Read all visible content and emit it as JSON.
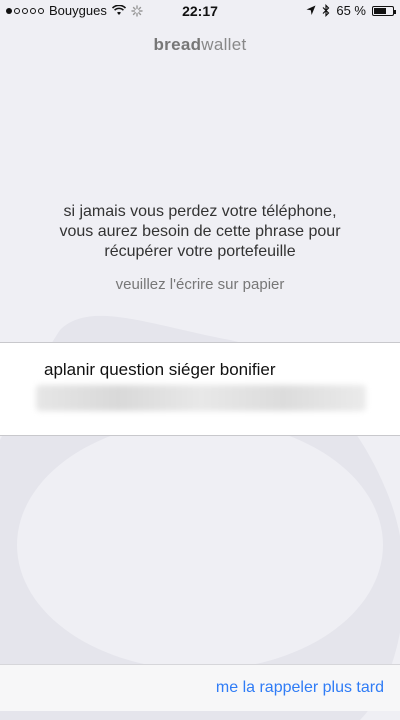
{
  "status_bar": {
    "carrier": "Bouygues",
    "time": "22:17",
    "battery_percent_label": "65 %",
    "battery_level": 0.65,
    "signal_bars_filled": 1,
    "signal_bars_total": 5,
    "icons": [
      "wifi-icon",
      "activity-spinner-icon",
      "location-arrow-icon",
      "bluetooth-icon",
      "battery-icon"
    ]
  },
  "logo": {
    "bold": "bread",
    "light": "wallet"
  },
  "message": {
    "lines": [
      "si jamais vous perdez votre téléphone,",
      "vous aurez besoin de cette phrase pour",
      "récupérer votre portefeuille"
    ]
  },
  "instruction": "veuillez l'écrire sur papier",
  "phrase": {
    "visible": "aplanir question siéger bonifier"
  },
  "actions": {
    "remind_later": "me la rappeler plus tard"
  },
  "colors": {
    "background": "#efeff4",
    "accent": "#2f7cf6",
    "panel": "#ffffff"
  }
}
